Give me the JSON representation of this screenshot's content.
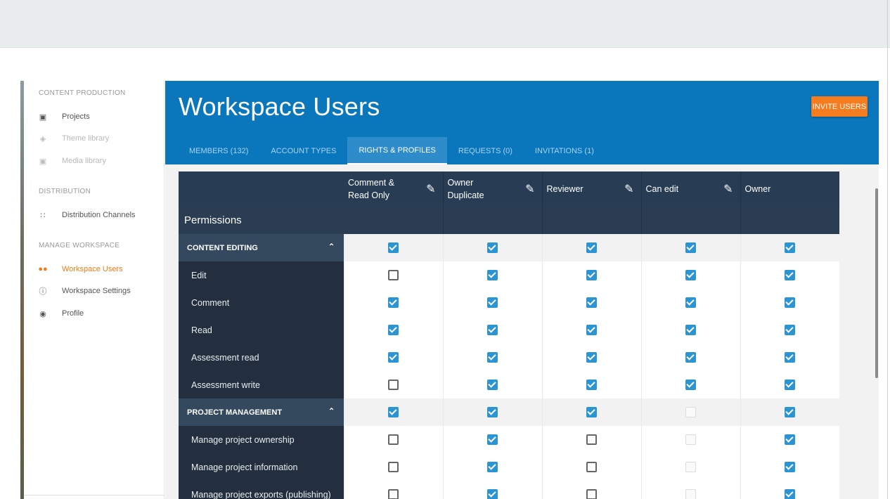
{
  "sidebar": {
    "sections": [
      {
        "label": "CONTENT PRODUCTION"
      },
      {
        "label": "DISTRIBUTION"
      },
      {
        "label": "MANAGE WORKSPACE"
      }
    ],
    "items": [
      {
        "label": "Projects",
        "icon": "projects-icon"
      },
      {
        "label": "Theme library",
        "icon": "theme-icon"
      },
      {
        "label": "Media library",
        "icon": "media-icon"
      },
      {
        "label": "Distribution Channels",
        "icon": "grid-icon"
      },
      {
        "label": "Workspace Users",
        "icon": "people-icon"
      },
      {
        "label": "Workspace Settings",
        "icon": "info-icon"
      },
      {
        "label": "Profile",
        "icon": "account-icon"
      }
    ]
  },
  "header": {
    "title": "Workspace Users",
    "invite_label": "INVITE USERS",
    "accent_color": "#0a77bd",
    "button_color": "#f57c1f",
    "tabs": [
      {
        "label": "MEMBERS (132)"
      },
      {
        "label": "ACCOUNT TYPES"
      },
      {
        "label": "RIGHTS & PROFILES"
      },
      {
        "label": "REQUESTS (0)"
      },
      {
        "label": "INVITATIONS (1)"
      }
    ]
  },
  "table": {
    "permissions_label": "Permissions",
    "columns": [
      {
        "label": "Comment &\nRead Only"
      },
      {
        "label": "Owner\nDuplicate"
      },
      {
        "label": "Reviewer"
      },
      {
        "label": "Can edit"
      },
      {
        "label": "Owner"
      }
    ],
    "groups": [
      {
        "label": "CONTENT EDITING",
        "values": [
          "on",
          "on",
          "on",
          "on",
          "on"
        ],
        "rows": [
          {
            "label": "Edit",
            "values": [
              "off",
              "on",
              "on",
              "on",
              "on"
            ]
          },
          {
            "label": "Comment",
            "values": [
              "on",
              "on",
              "on",
              "on",
              "on"
            ]
          },
          {
            "label": "Read",
            "values": [
              "on",
              "on",
              "on",
              "on",
              "on"
            ]
          },
          {
            "label": "Assessment read",
            "values": [
              "on",
              "on",
              "on",
              "on",
              "on"
            ]
          },
          {
            "label": "Assessment write",
            "values": [
              "off",
              "on",
              "on",
              "on",
              "on"
            ]
          }
        ]
      },
      {
        "label": "PROJECT MANAGEMENT",
        "values": [
          "on",
          "on",
          "on",
          "dis",
          "on"
        ],
        "rows": [
          {
            "label": "Manage project ownership",
            "values": [
              "off",
              "on",
              "off",
              "dis",
              "on"
            ]
          },
          {
            "label": "Manage project information",
            "values": [
              "off",
              "on",
              "off",
              "dis",
              "on"
            ]
          },
          {
            "label": "Manage project exports (publishing)",
            "values": [
              "off",
              "on",
              "off",
              "dis",
              "on"
            ]
          }
        ]
      }
    ]
  }
}
